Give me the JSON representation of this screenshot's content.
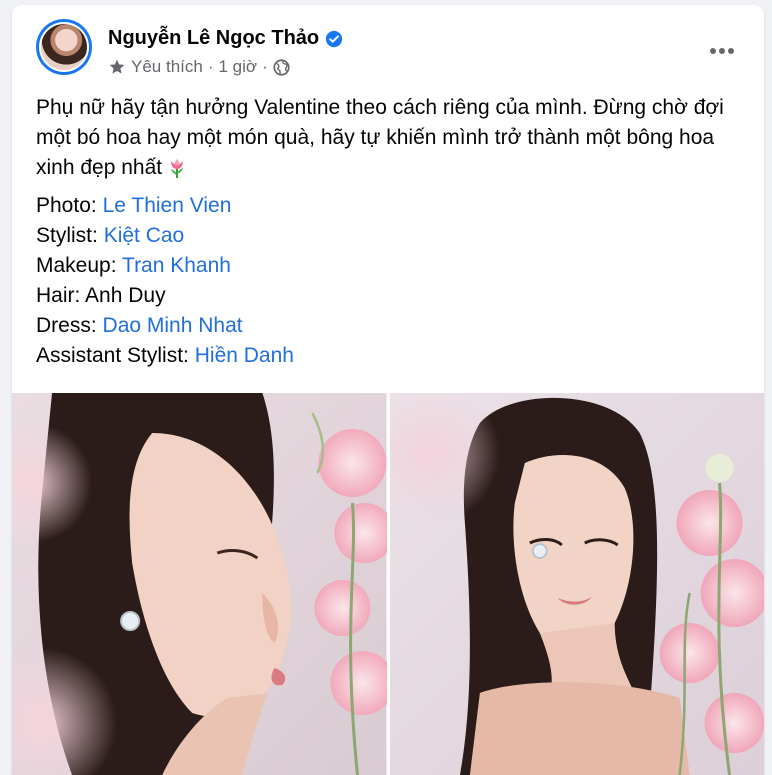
{
  "post": {
    "author": {
      "name": "Nguyễn Lê Ngọc Thảo",
      "verified": true
    },
    "meta": {
      "page_category": "Yêu thích",
      "separator": "·",
      "time": "1 giờ",
      "audience_icon": "globe-icon"
    },
    "text": "Phụ nữ hãy tận hưởng Valentine theo cách riêng của mình. Đừng chờ đợi một bó hoa hay một món quà, hãy tự khiến mình trở thành một bông hoa xinh đẹp nhất",
    "credits": [
      {
        "label": "Photo:",
        "value": "Le Thien Vien",
        "linked": true
      },
      {
        "label": "Stylist:",
        "value": "Kiệt Cao",
        "linked": true
      },
      {
        "label": "Makeup:",
        "value": "Tran Khanh",
        "linked": true
      },
      {
        "label": "Hair:",
        "value": "Anh Duy",
        "linked": false
      },
      {
        "label": "Dress:",
        "value": "Dao Minh Nhat",
        "linked": true
      },
      {
        "label": "Assistant Stylist:",
        "value": "Hiền Danh",
        "linked": true
      }
    ],
    "photos": [
      {
        "icon": "portrait-profile-photo"
      },
      {
        "icon": "portrait-front-photo"
      }
    ]
  },
  "colors": {
    "link": "#216fdb",
    "verified": "#1877f2",
    "meta_text": "#65676b",
    "background": "#f0f2f5"
  }
}
